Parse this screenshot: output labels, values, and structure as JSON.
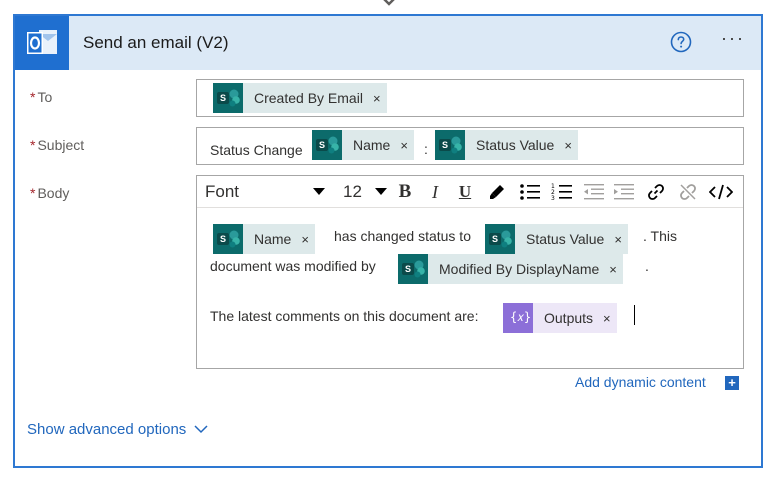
{
  "card": {
    "title": "Send an email (V2)",
    "accent_color": "#2e78d2",
    "header_bg": "#dce9f6",
    "icons": {
      "connector": "outlook-icon",
      "help": "help-circle-icon",
      "more": "more-dots-icon"
    },
    "more_label": "···"
  },
  "fields": {
    "to": {
      "required_mark": "*",
      "label": "To",
      "tokens": [
        {
          "text": "Created By Email",
          "close": "×",
          "icon": "sharepoint-icon"
        }
      ]
    },
    "subject": {
      "required_mark": "*",
      "label": "Subject",
      "prefix": "Status Change",
      "separator": ":",
      "tokens": [
        {
          "text": "Name",
          "close": "×",
          "icon": "sharepoint-icon"
        },
        {
          "text": "Status Value",
          "close": "×",
          "icon": "sharepoint-icon"
        }
      ]
    },
    "body": {
      "required_mark": "*",
      "label": "Body",
      "toolbar": {
        "font_label": "Font",
        "size_label": "12",
        "bold": "B",
        "italic": "I",
        "underline": "U",
        "icons": [
          "font-dropdown-icon",
          "size-dropdown-icon",
          "bold-icon",
          "italic-icon",
          "underline-icon",
          "highlight-icon",
          "bulleted-list-icon",
          "numbered-list-icon",
          "decrease-indent-icon",
          "increase-indent-icon",
          "link-icon",
          "unlink-icon",
          "code-view-icon"
        ]
      },
      "text_has_changed": "has changed status to",
      "text_this": ". This",
      "text_document_modified": "document was modified by",
      "text_period": ".",
      "text_latest_comments": "The latest comments on this document are:",
      "tokens": {
        "name": {
          "text": "Name",
          "close": "×",
          "icon": "sharepoint-icon"
        },
        "status_value": {
          "text": "Status Value",
          "close": "×",
          "icon": "sharepoint-icon"
        },
        "modified_by": {
          "text": "Modified By DisplayName",
          "close": "×",
          "icon": "sharepoint-icon"
        },
        "outputs": {
          "text": "Outputs",
          "close": "×",
          "icon": "expression-icon",
          "icon_text": "{𝑥}"
        }
      }
    }
  },
  "add_dynamic_content": {
    "label": "Add dynamic content",
    "icon": "plus-icon",
    "icon_text": "+"
  },
  "show_advanced_options": {
    "label": "Show advanced options",
    "icon": "chevron-down-icon"
  },
  "colors": {
    "token_bg": "#dde9ea",
    "sharepoint": "#0c6b6b",
    "expression_bg": "#ede7f7",
    "expression_icon": "#8c6fd8",
    "link": "#2167bd",
    "required": "#a4262c"
  }
}
